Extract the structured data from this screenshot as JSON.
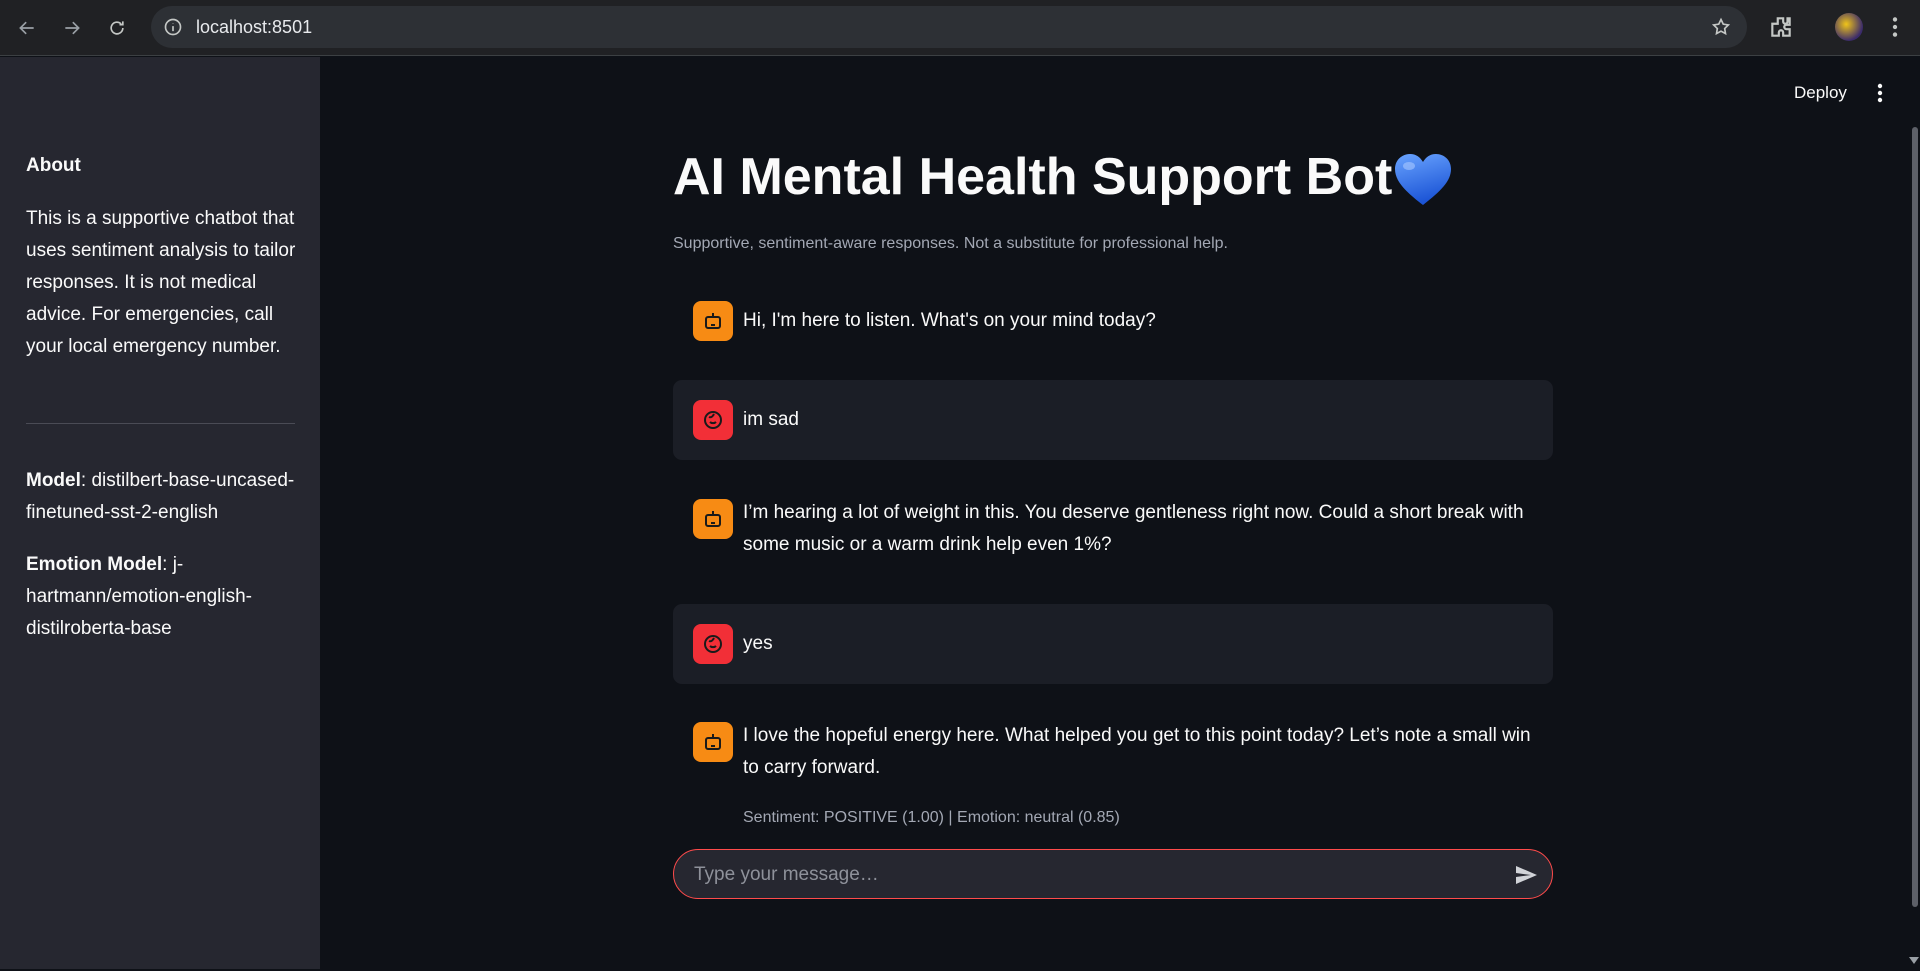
{
  "browser": {
    "url": "localhost:8501"
  },
  "sidebar": {
    "about_title": "About",
    "about_text": "This is a supportive chatbot that uses sentiment analysis to tailor responses. It is not medical advice. For emergencies, call your local emergency number.",
    "model_label": "Model",
    "model_value": ": distilbert-base-uncased-finetuned-sst-2-english",
    "emotion_model_label": "Emotion Model",
    "emotion_model_value": ": j-hartmann/emotion-english-distilroberta-base"
  },
  "header": {
    "deploy_label": "Deploy"
  },
  "main": {
    "title": "AI Mental Health Support Bot",
    "caption": "Supportive, sentiment-aware responses. Not a substitute for professional help."
  },
  "messages": [
    {
      "role": "assistant",
      "text": "Hi, I'm here to listen. What's on your mind today?"
    },
    {
      "role": "user",
      "text": "im sad"
    },
    {
      "role": "assistant",
      "text": "I’m hearing a lot of weight in this. You deserve gentleness right now. Could a short break with some music or a warm drink help even 1%?"
    },
    {
      "role": "user",
      "text": "yes"
    },
    {
      "role": "assistant",
      "text": "I love the hopeful energy here. What helped you get to this point today? Let’s note a small win to carry forward.",
      "meta": "Sentiment: POSITIVE (1.00) | Emotion: neutral (0.85)"
    }
  ],
  "chat_input": {
    "placeholder": "Type your message…"
  },
  "colors": {
    "bot_avatar": "#f78b14",
    "user_avatar": "#f22f37",
    "accent": "#ff4b4b",
    "heart": "#2f6fe8"
  }
}
